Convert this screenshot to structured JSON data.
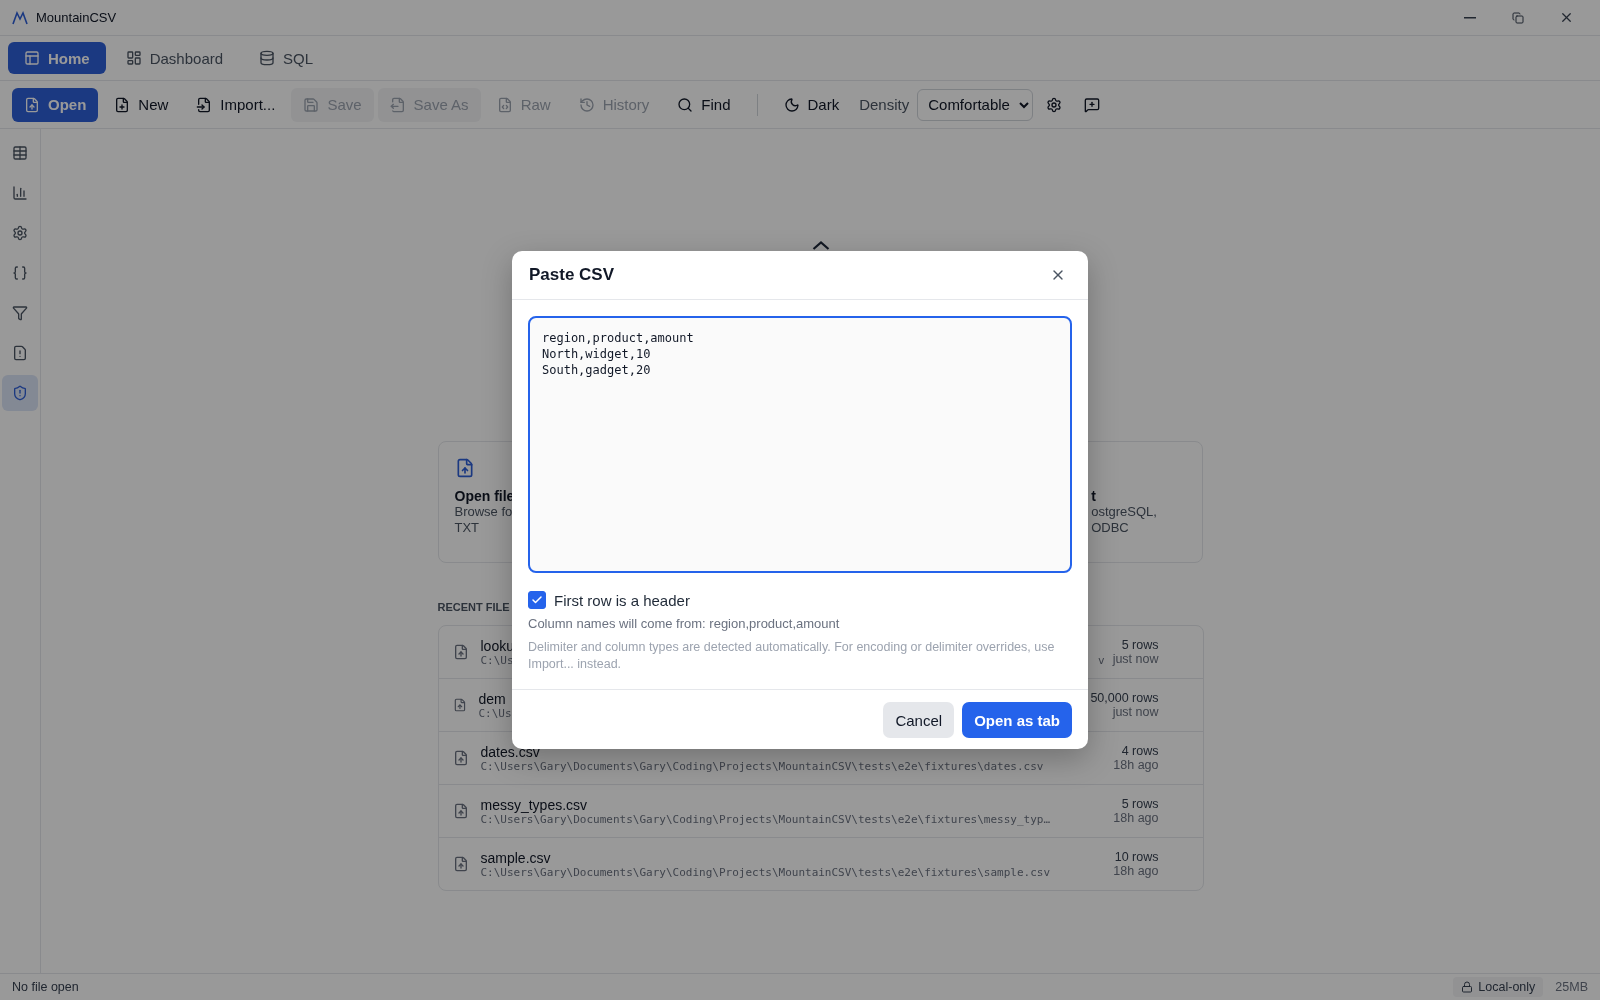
{
  "window": {
    "title": "MountainCSV"
  },
  "tabs": [
    {
      "label": "Home",
      "selected": true
    },
    {
      "label": "Dashboard",
      "selected": false
    },
    {
      "label": "SQL",
      "selected": false
    }
  ],
  "toolbar": [
    {
      "kind": "button",
      "label": "Open",
      "disabled": false
    },
    {
      "kind": "button",
      "label": "New",
      "disabled": false
    },
    {
      "kind": "button",
      "label": "Import...",
      "disabled": false
    },
    {
      "kind": "button",
      "label": "Save",
      "disabled": true
    },
    {
      "kind": "button",
      "label": "Save As",
      "disabled": true
    },
    {
      "kind": "button",
      "label": "Raw",
      "disabled": true
    },
    {
      "kind": "button",
      "label": "History",
      "disabled": true
    },
    {
      "kind": "button",
      "label": "Find",
      "disabled": false
    },
    {
      "kind": "divider"
    },
    {
      "kind": "button",
      "label": "Dark",
      "disabled": false
    },
    {
      "kind": "label",
      "label": "Density"
    },
    {
      "kind": "select",
      "value": "Comfortable"
    },
    {
      "kind": "icon"
    },
    {
      "kind": "icon"
    }
  ],
  "sidebar": [
    {
      "selected": false
    },
    {
      "selected": false
    },
    {
      "selected": false
    },
    {
      "selected": false
    },
    {
      "selected": false
    },
    {
      "selected": false
    },
    {
      "selected": true
    }
  ],
  "cards": [
    {
      "title": "Open file",
      "lines": [
        "Browse fo",
        "TXT"
      ]
    },
    {
      "title": "t",
      "lines": [
        "ostgreSQL,",
        "ODBC"
      ]
    }
  ],
  "recent": {
    "heading": "RECENT FILE",
    "rows": [
      {
        "name": "looku",
        "path": "C:\\Us",
        "path_tail": "v",
        "rows": "5 rows",
        "when": "just now"
      },
      {
        "name": "dem",
        "path": "C:\\Us",
        "rows": "50,000 rows",
        "when": "just now"
      },
      {
        "name": "dates.csv",
        "path": "C:\\Users\\Gary\\Documents\\Gary\\Coding\\Projects\\MountainCSV\\tests\\e2e\\fixtures\\dates.csv",
        "rows": "4 rows",
        "when": "18h ago"
      },
      {
        "name": "messy_types.csv",
        "path": "C:\\Users\\Gary\\Documents\\Gary\\Coding\\Projects\\MountainCSV\\tests\\e2e\\fixtures\\messy_typ…",
        "rows": "5 rows",
        "when": "18h ago"
      },
      {
        "name": "sample.csv",
        "path": "C:\\Users\\Gary\\Documents\\Gary\\Coding\\Projects\\MountainCSV\\tests\\e2e\\fixtures\\sample.csv",
        "rows": "10 rows",
        "when": "18h ago"
      }
    ]
  },
  "status_bar": {
    "left": "No file open",
    "badge": "Local-only",
    "memory": "25MB"
  },
  "dialog": {
    "title": "Paste CSV",
    "value": "region,product,amount\nNorth,widget,10\nSouth,gadget,20",
    "checkbox": {
      "label": "First row is a header",
      "checked": true
    },
    "hint": "Column names will come from: region,product,amount",
    "note": "Delimiter and column types are detected automatically. For encoding or delimiter overrides, use Import... instead.",
    "buttons": [
      "Cancel",
      "Open as tab"
    ]
  }
}
